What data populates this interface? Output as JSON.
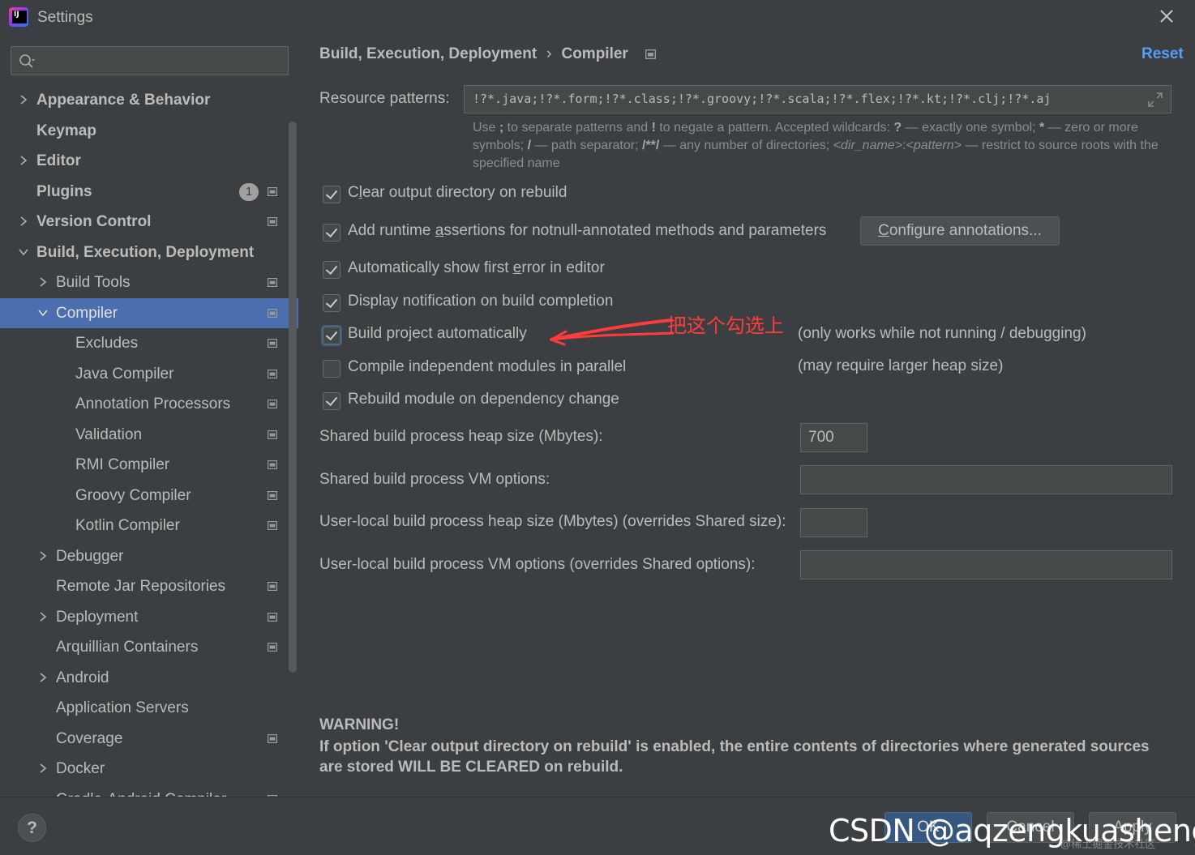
{
  "window": {
    "title": "Settings"
  },
  "sidebar": {
    "search_placeholder": "",
    "items": [
      {
        "label": "Appearance & Behavior",
        "bold": true,
        "level": 0,
        "expander": "collapsed",
        "project": false
      },
      {
        "label": "Keymap",
        "bold": true,
        "level": 0,
        "expander": "none",
        "project": false
      },
      {
        "label": "Editor",
        "bold": true,
        "level": 0,
        "expander": "collapsed",
        "project": false
      },
      {
        "label": "Plugins",
        "bold": true,
        "level": 0,
        "expander": "none",
        "project": true,
        "badge": "1"
      },
      {
        "label": "Version Control",
        "bold": true,
        "level": 0,
        "expander": "collapsed",
        "project": true
      },
      {
        "label": "Build, Execution, Deployment",
        "bold": true,
        "level": 0,
        "expander": "expanded",
        "project": false
      },
      {
        "label": "Build Tools",
        "bold": false,
        "level": 1,
        "expander": "collapsed",
        "project": true
      },
      {
        "label": "Compiler",
        "bold": false,
        "level": 1,
        "expander": "expanded",
        "project": true,
        "selected": true
      },
      {
        "label": "Excludes",
        "bold": false,
        "level": 2,
        "expander": "none",
        "project": true
      },
      {
        "label": "Java Compiler",
        "bold": false,
        "level": 2,
        "expander": "none",
        "project": true
      },
      {
        "label": "Annotation Processors",
        "bold": false,
        "level": 2,
        "expander": "none",
        "project": true
      },
      {
        "label": "Validation",
        "bold": false,
        "level": 2,
        "expander": "none",
        "project": true
      },
      {
        "label": "RMI Compiler",
        "bold": false,
        "level": 2,
        "expander": "none",
        "project": true
      },
      {
        "label": "Groovy Compiler",
        "bold": false,
        "level": 2,
        "expander": "none",
        "project": true
      },
      {
        "label": "Kotlin Compiler",
        "bold": false,
        "level": 2,
        "expander": "none",
        "project": true
      },
      {
        "label": "Debugger",
        "bold": false,
        "level": 1,
        "expander": "collapsed",
        "project": false
      },
      {
        "label": "Remote Jar Repositories",
        "bold": false,
        "level": 1,
        "expander": "none",
        "project": true
      },
      {
        "label": "Deployment",
        "bold": false,
        "level": 1,
        "expander": "collapsed",
        "project": true
      },
      {
        "label": "Arquillian Containers",
        "bold": false,
        "level": 1,
        "expander": "none",
        "project": true
      },
      {
        "label": "Android",
        "bold": false,
        "level": 1,
        "expander": "collapsed",
        "project": false
      },
      {
        "label": "Application Servers",
        "bold": false,
        "level": 1,
        "expander": "none",
        "project": false
      },
      {
        "label": "Coverage",
        "bold": false,
        "level": 1,
        "expander": "none",
        "project": true
      },
      {
        "label": "Docker",
        "bold": false,
        "level": 1,
        "expander": "collapsed",
        "project": false
      },
      {
        "label": "Gradle-Android Compiler",
        "bold": false,
        "level": 1,
        "expander": "none",
        "project": true
      }
    ]
  },
  "main": {
    "breadcrumb": {
      "parent": "Build, Execution, Deployment",
      "separator": "›",
      "current": "Compiler"
    },
    "reset_label": "Reset",
    "resource_patterns": {
      "label": "Resource patterns:",
      "value": "!?*.java;!?*.form;!?*.class;!?*.groovy;!?*.scala;!?*.flex;!?*.kt;!?*.clj;!?*.aj"
    },
    "hint": {
      "p1": "Use ",
      "k1": ";",
      "p2": " to separate patterns and ",
      "k2": "!",
      "p3": " to negate a pattern. Accepted wildcards: ",
      "k3": "?",
      "p4": " — exactly one symbol; ",
      "k4": "*",
      "p5": " — zero or more symbols; ",
      "k5": "/",
      "p6": " — path separator; ",
      "k6": "/**/",
      "p7": " — any number of directories; ",
      "i1": "<dir_name>",
      "p8": ":",
      "i2": "<pattern>",
      "p9": " — restrict to source roots with the specified name"
    },
    "options": {
      "clear_output": {
        "before": "C",
        "mnemonic": "l",
        "after": "ear output directory on rebuild",
        "checked": true
      },
      "runtime_assertions": {
        "before": "Add runtime ",
        "mnemonic": "a",
        "after": "ssertions for notnull-annotated methods and parameters",
        "checked": true
      },
      "configure_annotations": {
        "before": "",
        "mnemonic": "C",
        "after": "onfigure annotations..."
      },
      "show_first_error": {
        "before": "Automatically show first ",
        "mnemonic": "e",
        "after": "rror in editor",
        "checked": true
      },
      "display_notification": {
        "label": "Display notification on build completion",
        "checked": true
      },
      "build_automatically": {
        "label": "Build project automatically",
        "checked": true,
        "note": "(only works while not running / debugging)"
      },
      "compile_parallel": {
        "label": "Compile independent modules in parallel",
        "checked": false,
        "note": "(may require larger heap size)"
      },
      "rebuild_on_dependency": {
        "label": "Rebuild module on dependency change",
        "checked": true
      }
    },
    "shared_heap": {
      "label": "Shared build process heap size (Mbytes):",
      "value": "700"
    },
    "shared_vm": {
      "label": "Shared build process VM options:",
      "value": ""
    },
    "local_heap": {
      "label": "User-local build process heap size (Mbytes) (overrides Shared size):",
      "value": ""
    },
    "local_vm": {
      "label": "User-local build process VM options (overrides Shared options):",
      "value": ""
    },
    "annotation": {
      "text": "把这个勾选上",
      "color": "#ff3b3b"
    },
    "warning": {
      "title": "WARNING!",
      "body": "If option 'Clear output directory on rebuild' is enabled, the entire contents of directories where generated sources are stored WILL BE CLEARED on rebuild."
    }
  },
  "footer": {
    "help_label": "?",
    "ok_label": "OK",
    "cancel_label": "Cancel",
    "apply_label": "Apply",
    "watermark": "CSDN @aqzengkuasheng",
    "watermark_small": "@稀土掘金技术社区"
  },
  "colors": {
    "background": "#3c3f41",
    "selection": "#4b6eaf",
    "link": "#589df6",
    "text": "#bbbbbb"
  }
}
